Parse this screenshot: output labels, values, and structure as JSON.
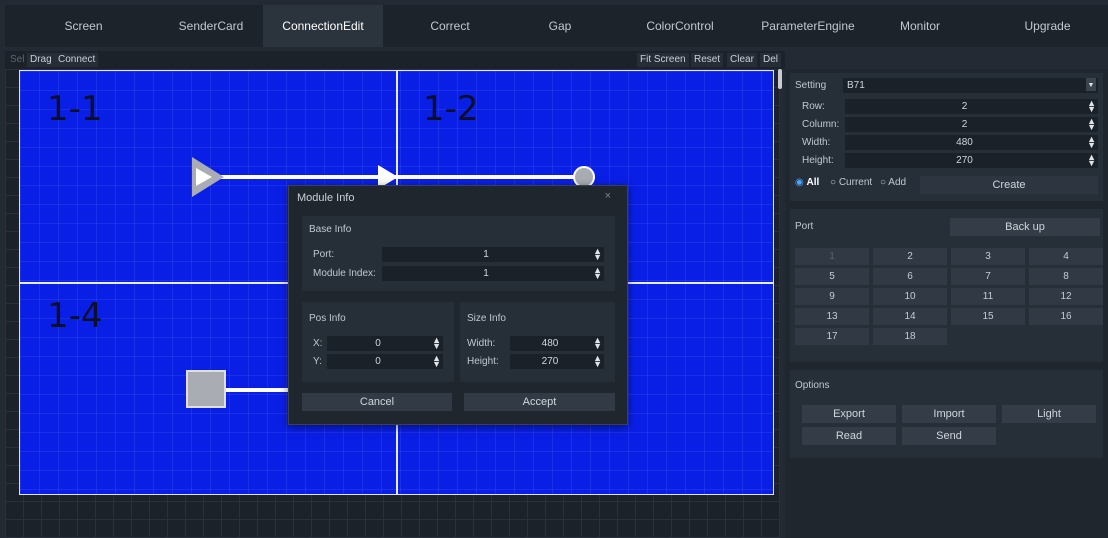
{
  "nav": {
    "tabs": [
      "Screen",
      "SenderCard",
      "ConnectionEdit",
      "Correct",
      "Gap",
      "ColorControl",
      "ParameterEngine",
      "Monitor",
      "Upgrade"
    ],
    "active": "ConnectionEdit"
  },
  "toolbar": {
    "left": [
      "Sel",
      "Drag",
      "Connect"
    ],
    "right": [
      "Fit Screen",
      "Reset",
      "Clear",
      "Del"
    ]
  },
  "modules": [
    "1-1",
    "1-2",
    "1-4"
  ],
  "settings": {
    "label": "Setting",
    "value": "B71",
    "rows": [
      {
        "label": "Row:",
        "value": "2"
      },
      {
        "label": "Column:",
        "value": "2"
      },
      {
        "label": "Width:",
        "value": "480"
      },
      {
        "label": "Height:",
        "value": "270"
      }
    ],
    "radios": [
      "All",
      "Current",
      "Add"
    ],
    "create": "Create"
  },
  "port": {
    "label": "Port",
    "backup": "Back up",
    "numbers": [
      "1",
      "2",
      "3",
      "4",
      "5",
      "6",
      "7",
      "8",
      "9",
      "10",
      "11",
      "12",
      "13",
      "14",
      "15",
      "16",
      "17",
      "18"
    ]
  },
  "options": {
    "label": "Options",
    "buttons": [
      "Export",
      "Import",
      "Light",
      "Read",
      "Send"
    ]
  },
  "dialog": {
    "title": "Module Info",
    "close": "×",
    "base": {
      "title": "Base Info",
      "port_label": "Port:",
      "port_value": "1",
      "index_label": "Module Index:",
      "index_value": "1"
    },
    "pos": {
      "title": "Pos Info",
      "x_label": "X:",
      "x_value": "0",
      "y_label": "Y:",
      "y_value": "0"
    },
    "size": {
      "title": "Size Info",
      "w_label": "Width:",
      "w_value": "480",
      "h_label": "Height:",
      "h_value": "270"
    },
    "cancel": "Cancel",
    "accept": "Accept"
  }
}
